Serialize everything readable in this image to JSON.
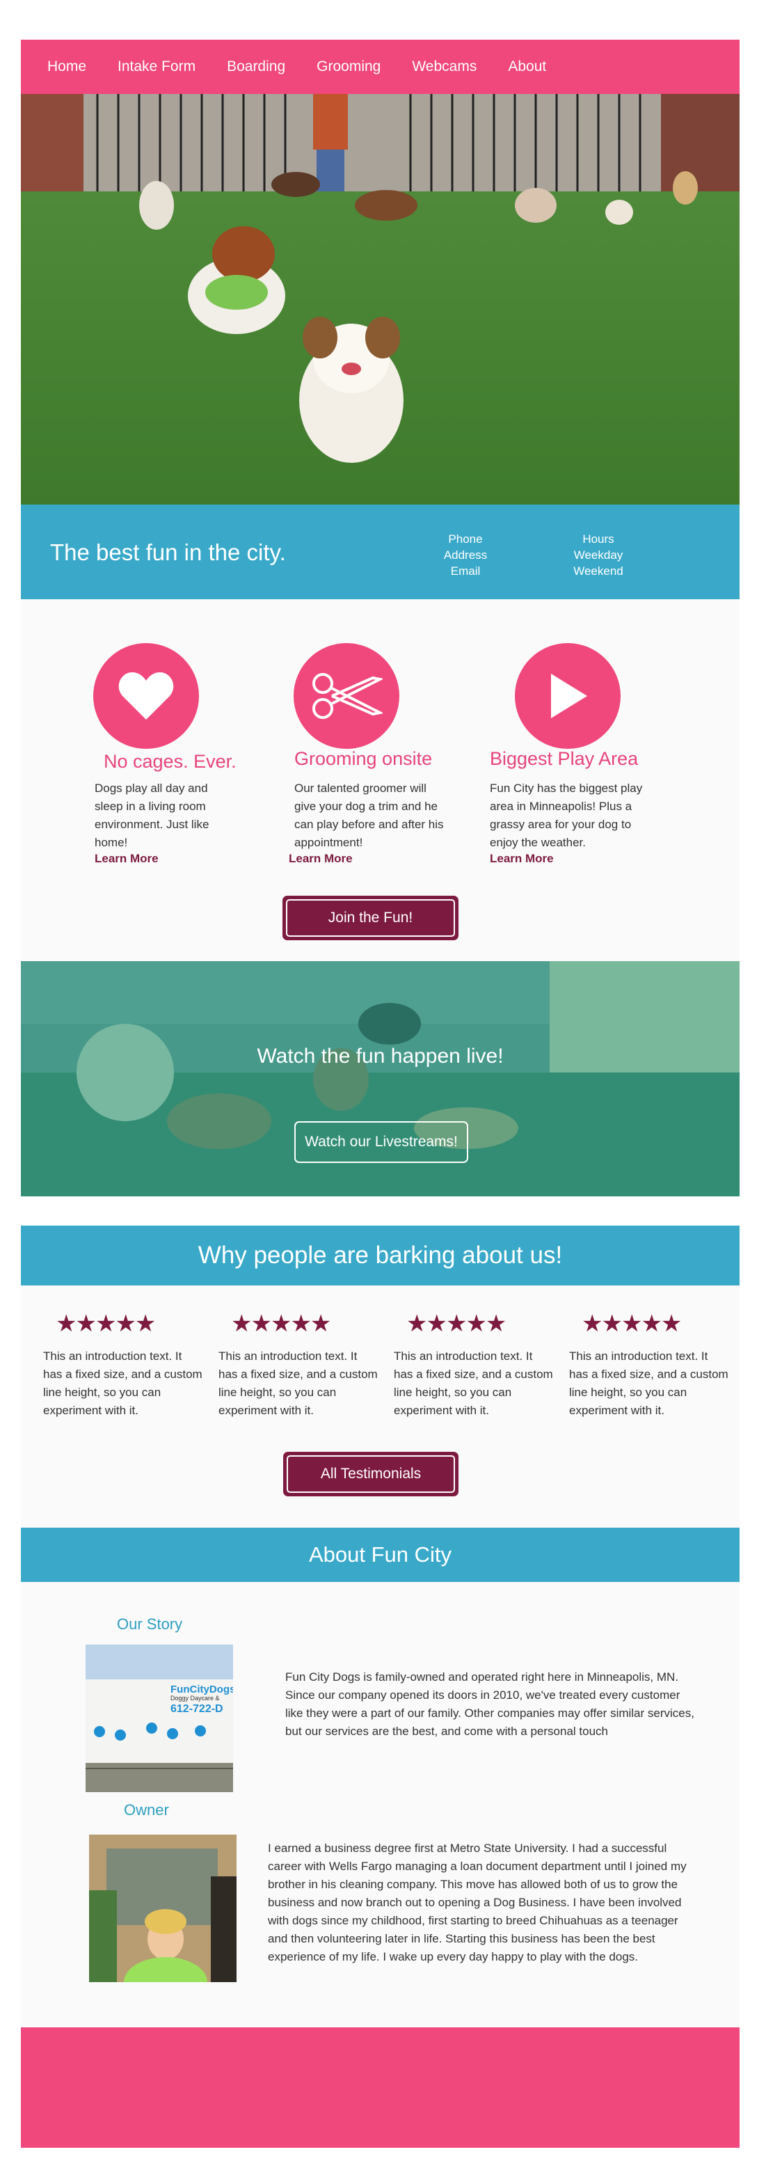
{
  "nav": {
    "items": [
      {
        "label": "Home"
      },
      {
        "label": "Intake Form"
      },
      {
        "label": "Boarding"
      },
      {
        "label": "Grooming"
      },
      {
        "label": "Webcams"
      },
      {
        "label": "About"
      }
    ]
  },
  "info_bar": {
    "tagline": "The best fun in the city.",
    "contact": {
      "phone": "Phone",
      "address": "Address",
      "email": "Email"
    },
    "hours": {
      "title": "Hours",
      "weekday": "Weekday",
      "weekend": "Weekend"
    }
  },
  "features": [
    {
      "icon": "heart-icon",
      "title": "No cages. Ever.",
      "text": "Dogs play all day and sleep in a living room environment.   Just like home!",
      "link": "Learn More"
    },
    {
      "icon": "scissors-icon",
      "title": "Grooming onsite",
      "text": " Our talented groomer will give your dog a trim and he can play before and after his appointment!",
      "link": "Learn More"
    },
    {
      "icon": "play-icon",
      "title": "Biggest Play Area",
      "text": "Fun City has the biggest play area in Minneapolis! Plus a grassy area for your dog to enjoy the weather.",
      "link": "Learn More"
    }
  ],
  "join_button": "Join the Fun!",
  "live": {
    "title": "Watch the fun happen live!",
    "button": "Watch our Livestreams!"
  },
  "testimonials": {
    "heading": "Why people are barking about us!",
    "stars": "★★★★★",
    "items": [
      {
        "text": "This an introduction text. It has a fixed size, and a custom line height, so you can experiment with it."
      },
      {
        "text": "This an introduction text. It has a fixed size, and a custom line height, so you can experiment with it."
      },
      {
        "text": "This an introduction text. It has a fixed size, and a custom line height, so you can experiment with it."
      },
      {
        "text": "This an introduction text. It has a fixed size, and a custom line height, so you can experiment with it."
      }
    ],
    "button": "All Testimonials"
  },
  "about": {
    "heading": "About Fun City",
    "story_label": "Our Story",
    "story_text": "Fun City Dogs is family-owned and operated right here in Minneapolis, MN. Since our company opened its doors in 2010, we've treated every customer like they were a part of our family. Other companies may offer similar services, but our services are the best, and come with a personal touch",
    "storefront_sign": "FunCityDogs",
    "storefront_sub": "Doggy Daycare &",
    "storefront_phone": "612-722-D",
    "owner_label": "Owner",
    "owner_text": "I earned a business degree first at Metro State University.  I had a successful career with Wells Fargo managing a loan document department until I joined my brother in his cleaning company. This move has allowed both of us to grow the business and now branch out to opening a Dog Business. I have been involved with dogs since my childhood, first starting to breed Chihuahuas as a teenager and then volunteering later in life. Starting this business has been the best experience of my life. I wake up every day happy to play with the dogs."
  },
  "colors": {
    "pink": "#f0477c",
    "blue": "#3aa9c9",
    "maroon": "#7d1a3f",
    "teal_overlay": "#2aa58e"
  }
}
